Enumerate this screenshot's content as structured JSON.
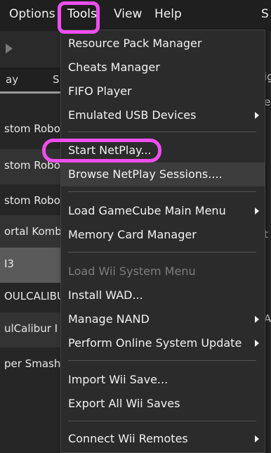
{
  "menubar": {
    "items": [
      "Options",
      "Tools",
      "View",
      "Help"
    ],
    "active": "Tools",
    "right_fragment": "S"
  },
  "table": {
    "header": [
      "ay",
      "S"
    ],
    "rows": [
      "stom Robo",
      "stom Robo",
      "stom Robo",
      "ortal Komb",
      "I3",
      "OULCALIBU",
      "ulCalibur I",
      "per Smash"
    ],
    "right_column": [
      "ig",
      "e",
      "t",
      "Al"
    ]
  },
  "tools_menu": {
    "items": [
      {
        "label": "Resource Pack Manager",
        "enabled": true,
        "submenu": false
      },
      {
        "label": "Cheats Manager",
        "enabled": true,
        "submenu": false
      },
      {
        "label": "FIFO Player",
        "enabled": true,
        "submenu": false
      },
      {
        "label": "Emulated USB Devices",
        "enabled": true,
        "submenu": true
      },
      {
        "label": "Start NetPlay...",
        "enabled": true,
        "submenu": false
      },
      {
        "label": "Browse NetPlay Sessions....",
        "enabled": true,
        "submenu": false
      },
      {
        "label": "Load GameCube Main Menu",
        "enabled": true,
        "submenu": true
      },
      {
        "label": "Memory Card Manager",
        "enabled": true,
        "submenu": false
      },
      {
        "label": "Load Wii System Menu",
        "enabled": false,
        "submenu": false
      },
      {
        "label": "Install WAD...",
        "enabled": true,
        "submenu": false
      },
      {
        "label": "Manage NAND",
        "enabled": true,
        "submenu": true
      },
      {
        "label": "Perform Online System Update",
        "enabled": true,
        "submenu": true
      },
      {
        "label": "Import Wii Save...",
        "enabled": true,
        "submenu": false
      },
      {
        "label": "Export All Wii Saves",
        "enabled": true,
        "submenu": false
      },
      {
        "label": "Connect Wii Remotes",
        "enabled": true,
        "submenu": true
      }
    ],
    "highlighted": "Browse NetPlay Sessions...."
  },
  "annotations": {
    "color": "#ee4fee",
    "circled": [
      "Tools",
      "Start NetPlay..."
    ]
  },
  "colors": {
    "menu_bg": "#2b2b2b",
    "app_bg": "#1e1e1e",
    "selected_row": "#5a5a5a"
  }
}
